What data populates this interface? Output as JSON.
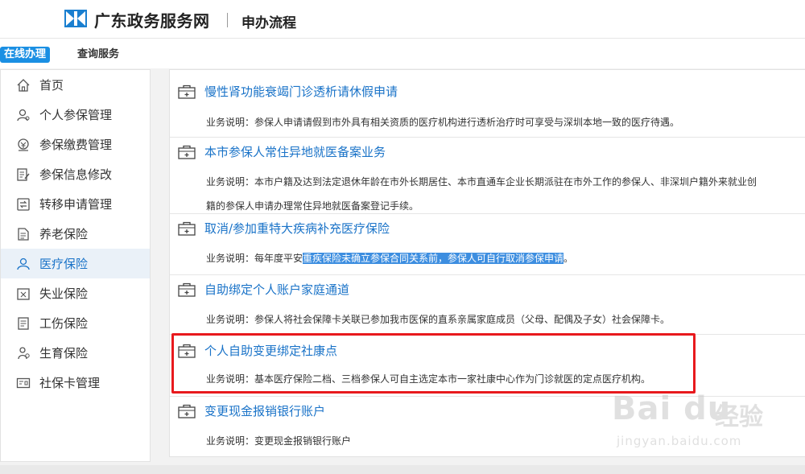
{
  "header": {
    "site_name": "广东政务服务网",
    "page_title": "申办流程"
  },
  "tabs": [
    {
      "label": "在线办理",
      "active": true
    },
    {
      "label": "查询服务",
      "active": false
    }
  ],
  "sidebar": {
    "items": [
      {
        "label": "首页",
        "icon": "home-icon"
      },
      {
        "label": "个人参保管理",
        "icon": "person-icon"
      },
      {
        "label": "参保缴费管理",
        "icon": "payment-icon"
      },
      {
        "label": "参保信息修改",
        "icon": "edit-doc-icon"
      },
      {
        "label": "转移申请管理",
        "icon": "transfer-icon"
      },
      {
        "label": "养老保险",
        "icon": "document-icon"
      },
      {
        "label": "医疗保险",
        "icon": "person-icon",
        "active": true
      },
      {
        "label": "失业保险",
        "icon": "unemployment-icon"
      },
      {
        "label": "工伤保险",
        "icon": "document-icon"
      },
      {
        "label": "生育保险",
        "icon": "person-icon"
      },
      {
        "label": "社保卡管理",
        "icon": "card-icon"
      }
    ]
  },
  "services": [
    {
      "title": "慢性肾功能衰竭门诊透析请休假申请",
      "desc": "业务说明：参保人申请请假到市外具有相关资质的医疗机构进行透析治疗时可享受与深圳本地一致的医疗待遇。"
    },
    {
      "title": "本市参保人常住异地就医备案业务",
      "desc": "业务说明：本市户籍及达到法定退休年龄在市外长期居住、本市直通车企业长期派驻在市外工作的参保人、非深圳户籍外来就业创",
      "desc2": "籍的参保人申请办理常住异地就医备案登记手续。"
    },
    {
      "title": "取消/参加重特大疾病补充医疗保险",
      "desc_prefix": "业务说明：每年度平安",
      "desc_highlight": "重疾保险未确立参保合同关系前，参保人可自行取消参保申请",
      "desc_suffix": "。"
    },
    {
      "title": "自助绑定个人账户家庭通道",
      "desc": "业务说明：参保人将社会保障卡关联已参加我市医保的直系亲属家庭成员（父母、配偶及子女）社会保障卡。"
    },
    {
      "title": "个人自助变更绑定社康点",
      "desc": "业务说明：基本医疗保险二档、三档参保人可自主选定本市一家社康中心作为门诊就医的定点医疗机构。"
    },
    {
      "title": "变更现金报销银行账户",
      "desc": "业务说明：变更现金报销银行账户"
    }
  ],
  "watermark": {
    "logo": "Bai du",
    "text": "经验",
    "url": "jingyan.baidu.com"
  },
  "colors": {
    "accent": "#1a8fe3",
    "link": "#1a73c8",
    "highlight_box": "#e8191d"
  }
}
